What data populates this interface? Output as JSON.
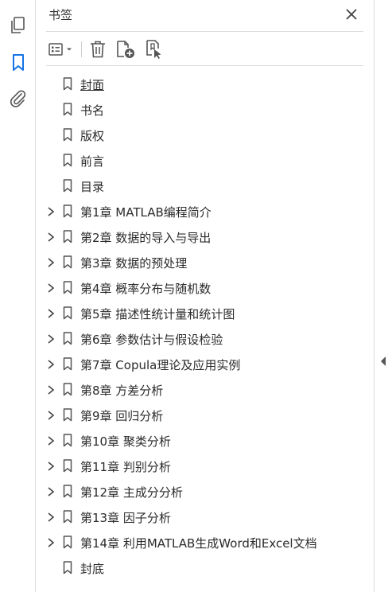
{
  "panel": {
    "title": "书签"
  },
  "rail": {
    "icons": [
      "pages-icon",
      "bookmark-icon",
      "attachment-icon"
    ]
  },
  "toolbar": {
    "icons": [
      "options-menu-icon",
      "delete-icon",
      "new-bookmark-icon",
      "bookmark-from-selection-icon"
    ]
  },
  "colors": {
    "accent": "#1473e6",
    "icon": "#555555",
    "rule": "#dcdcdc"
  },
  "bookmarks": [
    {
      "label": "封面",
      "expandable": false,
      "selected": true
    },
    {
      "label": "书名",
      "expandable": false
    },
    {
      "label": "版权",
      "expandable": false
    },
    {
      "label": "前言",
      "expandable": false
    },
    {
      "label": "目录",
      "expandable": false
    },
    {
      "label": "第1章  MATLAB编程简介",
      "expandable": true
    },
    {
      "label": "第2章  数据的导入与导出",
      "expandable": true
    },
    {
      "label": "第3章  数据的预处理",
      "expandable": true
    },
    {
      "label": "第4章  概率分布与随机数",
      "expandable": true
    },
    {
      "label": "第5章  描述性统计量和统计图",
      "expandable": true
    },
    {
      "label": "第6章  参数估计与假设检验",
      "expandable": true
    },
    {
      "label": "第7章  Copula理论及应用实例",
      "expandable": true
    },
    {
      "label": "第8章  方差分析",
      "expandable": true
    },
    {
      "label": "第9章  回归分析",
      "expandable": true
    },
    {
      "label": "第10章  聚类分析",
      "expandable": true
    },
    {
      "label": "第11章  判别分析",
      "expandable": true
    },
    {
      "label": "第12章  主成分分析",
      "expandable": true
    },
    {
      "label": "第13章  因子分析",
      "expandable": true
    },
    {
      "label": "第14章  利用MATLAB生成Word和Excel文档",
      "expandable": true
    },
    {
      "label": "封底",
      "expandable": false
    }
  ]
}
